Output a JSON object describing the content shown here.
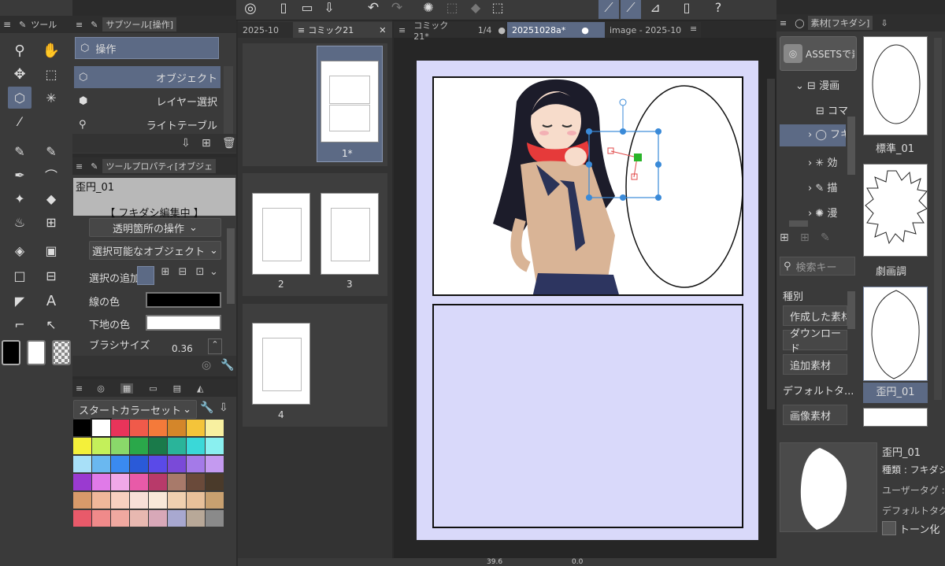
{
  "tool_panel": {
    "title": "ツール"
  },
  "subtool_panel": {
    "title": "サブツール[操作]",
    "group_label": "操作",
    "items": [
      {
        "label": "オブジェクト"
      },
      {
        "label": "レイヤー選択"
      },
      {
        "label": "ライトテーブル"
      }
    ]
  },
  "tool_property": {
    "title": "ツールプロパティ[オブジェ",
    "preview_name": "歪円_01",
    "preview_status": "【 フキダシ編集中 】",
    "transparent_op": "透明箇所の操作",
    "selectable_obj": "選択可能なオブジェクト",
    "add_selection_label": "選択の追加",
    "line_color_label": "線の色",
    "base_color_label": "下地の色",
    "brush_size_label": "ブラシサイズ",
    "brush_size_value": "0.36",
    "line_color": "#000000",
    "base_color": "#ffffff"
  },
  "color_set": {
    "dropdown": "スタートカラーセット",
    "colors": [
      "#000000",
      "#ffffff",
      "#e8345a",
      "#f05a4a",
      "#f47a3a",
      "#d4862a",
      "#f4c43a",
      "#f8f0a0",
      "#f4f03a",
      "#c4f05a",
      "#8ad86a",
      "#2aa84a",
      "#1a7a4a",
      "#2ab49a",
      "#3ad8d8",
      "#8af0f0",
      "#a8e0f8",
      "#6ab8f0",
      "#3a8af0",
      "#2a5ad8",
      "#5a4ae8",
      "#7a4ad8",
      "#a47ae8",
      "#c49af0",
      "#9a3ad0",
      "#e07ae8",
      "#f0a8e8",
      "#e85aa8",
      "#b83a6a",
      "#a87a6a",
      "#6a4a3a",
      "#4a3a2a",
      "#d89a6a",
      "#f0b89a",
      "#f8d0c0",
      "#f8e0d8",
      "#f8e8d8",
      "#f0d0b0",
      "#e8c09a",
      "#c8a070",
      "#e85a6a",
      "#f08a8a",
      "#f0a8a0",
      "#e8b8b0",
      "#d8a8b8",
      "#a8a8d0",
      "#b8a898",
      "#8a8a8a"
    ]
  },
  "tabs": {
    "left_doc_1": "2025-10",
    "left_doc_2": "コミック21",
    "right_doc_1": "コミック21*",
    "right_doc_page": "1/4",
    "right_doc_2": "20251028a*",
    "right_doc_3": "image - 2025-10"
  },
  "pages": [
    {
      "label": "1*"
    },
    {
      "label": "2"
    },
    {
      "label": "3"
    },
    {
      "label": "4"
    }
  ],
  "materials": {
    "title": "素材[フキダシ]",
    "assets_button": "ASSETSで素",
    "tree": [
      {
        "label": "漫画"
      },
      {
        "label": "コマ"
      },
      {
        "label": "フキ"
      },
      {
        "label": "効"
      },
      {
        "label": "描"
      },
      {
        "label": "漫"
      }
    ],
    "search_placeholder": "検索キー",
    "category_label": "種別",
    "category_buttons": [
      {
        "label": "作成した素材"
      },
      {
        "label": "ダウンロード"
      },
      {
        "label": "追加素材"
      },
      {
        "label": "デフォルトタ..."
      },
      {
        "label": "画像素材"
      }
    ],
    "thumbs": [
      {
        "label": "標準_01"
      },
      {
        "label": "劇画調"
      },
      {
        "label": "歪円_01"
      }
    ],
    "detail": {
      "name": "歪円_01",
      "type": "種類 : フキダシ",
      "user_tag": "ユーザータグ : C",
      "default_tag": "デフォルトタグ : フ",
      "tone_label": "トーン化"
    }
  },
  "status": {
    "zoom": "39.6",
    "angle": "0.0"
  }
}
